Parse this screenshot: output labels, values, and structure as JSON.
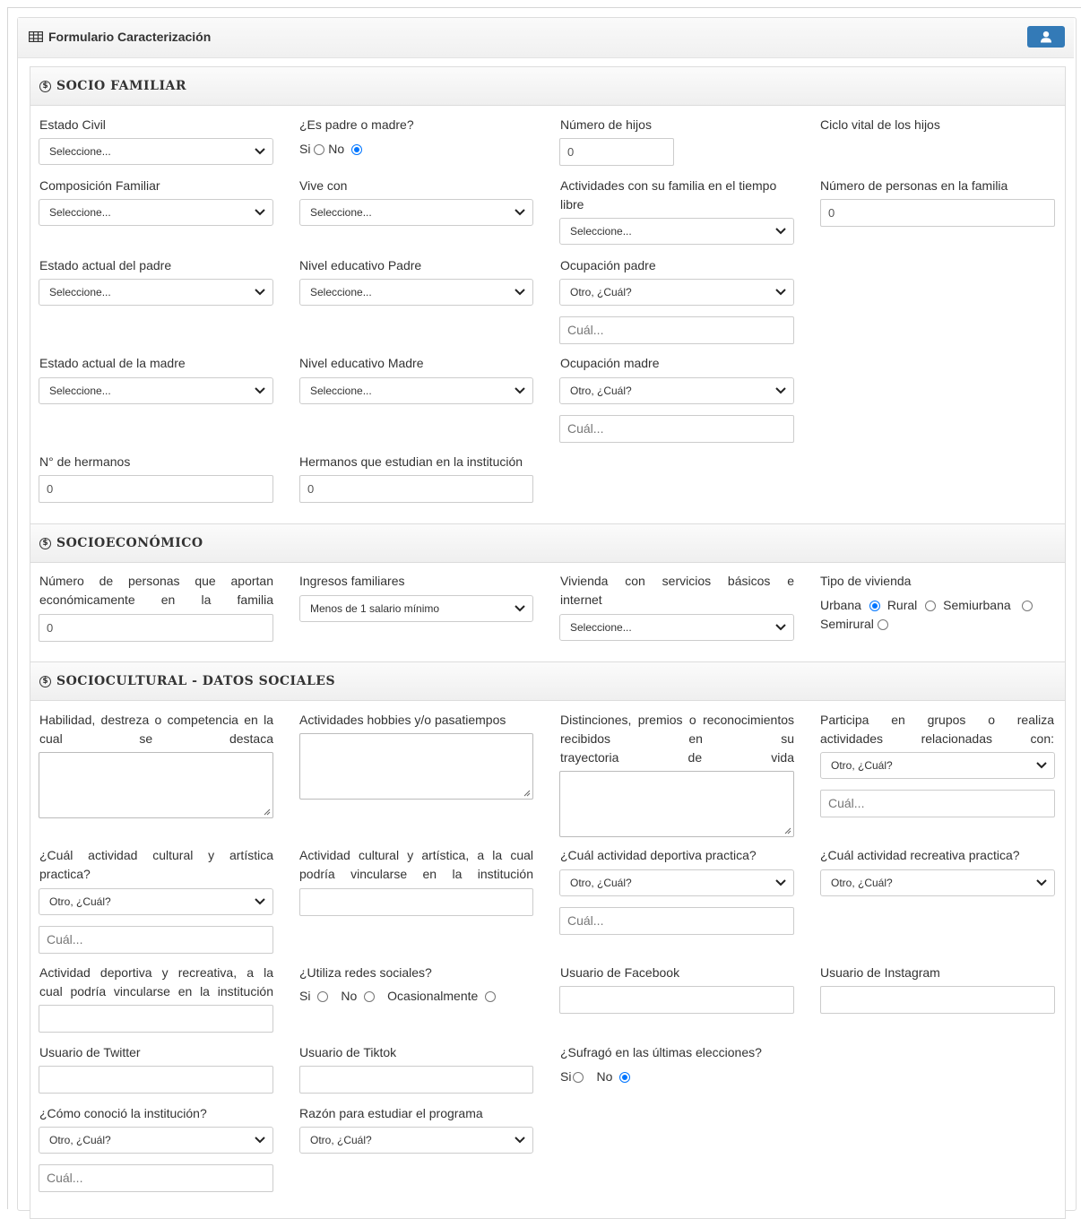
{
  "form": {
    "title": "Formulario Caracterización"
  },
  "icons": {
    "table": "table-icon",
    "user": "user-icon",
    "section": "dollar-coin-icon",
    "dropdown": "chevron-down-icon"
  },
  "accent": "#337ab7",
  "sections": {
    "socio_familiar": {
      "title": "SOCIO FAMILIAR",
      "estado_civil": {
        "label": "Estado Civil",
        "value": "Seleccione..."
      },
      "es_padre": {
        "label": "¿Es padre o madre?",
        "options": [
          "Si",
          "No"
        ],
        "selected": "No"
      },
      "numero_hijos": {
        "label": "Número de hijos",
        "value": "0"
      },
      "ciclo_vital": {
        "label": "Ciclo vital de los hijos"
      },
      "composicion": {
        "label": "Composición Familiar",
        "value": "Seleccione..."
      },
      "vive_con": {
        "label": "Vive con",
        "value": "Seleccione..."
      },
      "actividades_familia": {
        "label_line1": "Actividades con su familia en el tiempo",
        "label_line2": "libre",
        "value": "Seleccione..."
      },
      "personas_familia": {
        "label": "Número de personas en la familia",
        "value": "0"
      },
      "estado_padre": {
        "label": "Estado actual del padre",
        "value": "Seleccione..."
      },
      "nivel_padre": {
        "label": "Nivel educativo Padre",
        "value": "Seleccione..."
      },
      "ocupacion_padre": {
        "label": "Ocupación padre",
        "value": "Otro, ¿Cuál?",
        "placeholder": "Cuál..."
      },
      "estado_madre": {
        "label": "Estado actual de la madre",
        "value": "Seleccione..."
      },
      "nivel_madre": {
        "label": "Nivel educativo Madre",
        "value": "Seleccione..."
      },
      "ocupacion_madre": {
        "label": "Ocupación madre",
        "value": "Otro, ¿Cuál?",
        "placeholder": "Cuál..."
      },
      "hermanos": {
        "label": "N° de hermanos",
        "value": "0"
      },
      "hermanos_institucion": {
        "label": "Hermanos que estudian en la institución",
        "value": "0"
      }
    },
    "socioeconomico": {
      "title": "SOCIOECONÓMICO",
      "aportan": {
        "label_line1": "Número de personas que aportan",
        "label_line2": "económicamente en la familia",
        "value": "0"
      },
      "ingresos": {
        "label": "Ingresos familiares",
        "value": "Menos de 1 salario mínimo"
      },
      "vivienda_servicios": {
        "label_line1": "Vivienda con servicios básicos e",
        "label_line2": "internet",
        "value": "Seleccione..."
      },
      "tipo_vivienda": {
        "label": "Tipo de vivienda",
        "options": [
          "Urbana",
          "Rural",
          "Semiurbana",
          "Semirural"
        ],
        "selected": "Urbana"
      }
    },
    "sociocultural": {
      "title": "SOCIOCULTURAL - DATOS SOCIALES",
      "habilidad": {
        "label_line1": "Habilidad, destreza o competencia en la",
        "label_line2": "cual se destaca"
      },
      "hobbies": {
        "label": "Actividades hobbies y/o pasatiempos"
      },
      "distinciones": {
        "label_line1": "Distinciones, premios o",
        "label_line2": "reconocimientos recibidos en su",
        "label_line3": "trayectoria de vida"
      },
      "grupos": {
        "label_line1": "Participa en grupos o realiza",
        "label_line2": "actividades relacionadas con:",
        "value": "Otro, ¿Cuál?",
        "placeholder": "Cuál..."
      },
      "cultural_practica": {
        "label_line1": "¿Cuál actividad cultural y artística",
        "label_line2": "practica?",
        "value": "Otro, ¿Cuál?",
        "placeholder": "Cuál..."
      },
      "cultural_vincular": {
        "label_line1": "Actividad cultural y artística, a la cual",
        "label_line2": "podría vincularse en la institución"
      },
      "deportiva": {
        "label": "¿Cuál actividad deportiva practica?",
        "value": "Otro, ¿Cuál?",
        "placeholder": "Cuál..."
      },
      "recreativa": {
        "label": "¿Cuál actividad recreativa practica?",
        "value": "Otro, ¿Cuál?"
      },
      "deportiva_vincular": {
        "label_line1": "Actividad deportiva y recreativa, a la",
        "label_line2": "cual podría vincularse en la institución"
      },
      "redes": {
        "label": "¿Utiliza redes sociales?",
        "options": [
          "Si",
          "No",
          "Ocasionalmente"
        ],
        "selected": ""
      },
      "facebook": {
        "label": "Usuario de Facebook"
      },
      "instagram": {
        "label": "Usuario de Instagram"
      },
      "twitter": {
        "label": "Usuario de Twitter"
      },
      "tiktok": {
        "label": "Usuario de Tiktok"
      },
      "sufrago": {
        "label": "¿Sufragó en las últimas elecciones?",
        "options": [
          "Si",
          "No"
        ],
        "selected": "No"
      },
      "conocio": {
        "label": "¿Cómo conoció la institución?",
        "value": "Otro, ¿Cuál?",
        "placeholder": "Cuál..."
      },
      "razon": {
        "label": "Razón para estudiar el programa",
        "value": "Otro, ¿Cuál?"
      }
    }
  }
}
